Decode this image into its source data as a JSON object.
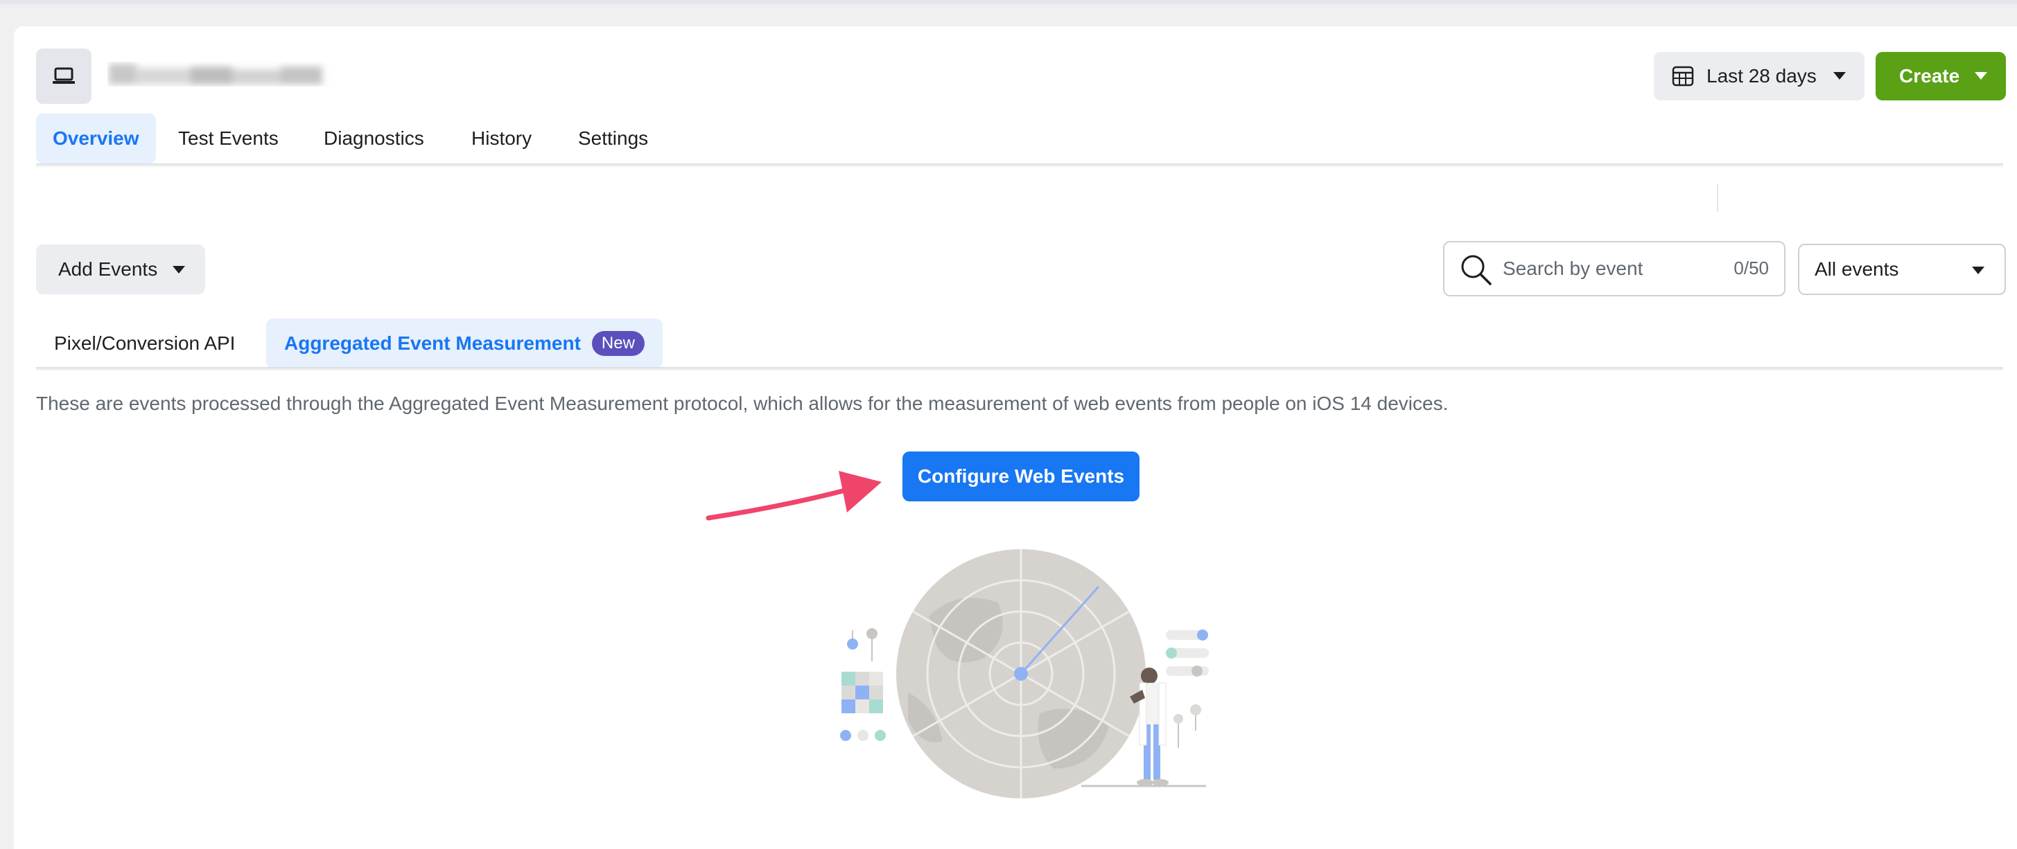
{
  "header": {
    "date_range_label": "Last 28 days",
    "create_label": "Create"
  },
  "main_tabs": [
    {
      "label": "Overview",
      "active": true
    },
    {
      "label": "Test Events",
      "active": false
    },
    {
      "label": "Diagnostics",
      "active": false
    },
    {
      "label": "History",
      "active": false
    },
    {
      "label": "Settings",
      "active": false
    }
  ],
  "toolbar": {
    "add_events_label": "Add Events",
    "search_placeholder": "Search by event",
    "search_counter": "0/50",
    "events_filter_value": "All events"
  },
  "sub_tabs": [
    {
      "label": "Pixel/Conversion API",
      "active": false
    },
    {
      "label": "Aggregated Event Measurement",
      "active": true,
      "badge": "New"
    }
  ],
  "description": "These are events processed through the Aggregated Event Measurement protocol, which allows for the measurement of web events from people on iOS 14 devices.",
  "configure_button_label": "Configure Web Events",
  "colors": {
    "primary_blue": "#1877f2",
    "create_green": "#5aa116",
    "badge_purple": "#5b4fbd",
    "arrow_pink": "#f0456b"
  },
  "icons": [
    "laptop-icon",
    "calendar-table-icon",
    "chevron-down-icon",
    "search-icon",
    "arrow-annotation",
    "radar-illustration"
  ]
}
